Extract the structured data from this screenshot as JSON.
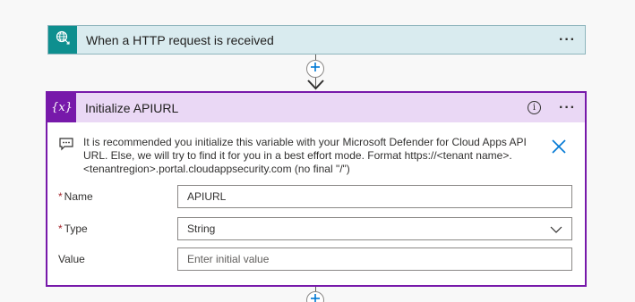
{
  "trigger": {
    "title": "When a HTTP request is received",
    "more_label": "···"
  },
  "action": {
    "title": "Initialize APIURL",
    "icon_text": "{x}",
    "info_label": "i",
    "more_label": "···",
    "notice": "It is recommended you initialize this variable with your Microsoft Defender for Cloud Apps API URL. Else, we will try to find it for you in a best effort mode. Format https://<tenant name>.<tenantregion>.portal.cloudappsecurity.com (no final \"/\")",
    "fields": {
      "name": {
        "required_mark": "*",
        "label": "Name",
        "value": "APIURL"
      },
      "type": {
        "required_mark": "*",
        "label": "Type",
        "value": "String"
      },
      "value": {
        "label": "Value",
        "placeholder": "Enter initial value"
      }
    }
  },
  "colors": {
    "trigger_accent": "#0e8f8f",
    "trigger_header_bg": "#d9ebef",
    "action_accent": "#7719aa",
    "action_header_bg": "#ead8f5",
    "add_step_plus": "#0078d4",
    "required_mark": "#a4262c"
  },
  "icons": {
    "trigger": "globe-request-icon",
    "action": "variable-icon",
    "notice": "comment-icon",
    "close": "close-icon",
    "add": "plus-icon",
    "type_dropdown": "chevron-down-icon"
  }
}
